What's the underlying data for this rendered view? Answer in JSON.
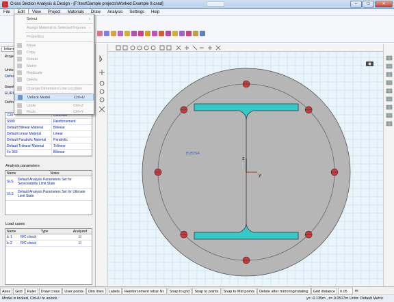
{
  "window": {
    "title": "Cross Section Analysis & Design - [F:\\test\\Sample projects\\Worked Example 9.csad]",
    "min": "–",
    "max": "□",
    "close": "✕"
  },
  "menu": [
    "File",
    "Edit",
    "View",
    "Project",
    "Materials",
    "Draw",
    "Analysis",
    "Settings",
    "Help"
  ],
  "edit_menu": {
    "select": "Select",
    "assign_material": "Assign Material to Selected Figures",
    "properties": "Properties",
    "move": "Move",
    "copy": "Copy",
    "rotate": "Rotate",
    "mirror": "Mirror",
    "replicate": "Replicate",
    "delete": "Delete",
    "change_dim": "Change Dimension Line Location",
    "unlock": "Unlock Model",
    "unlock_sc": "Ctrl+U",
    "undo": "Undo",
    "undo_sc": "Ctrl+Z",
    "redo": "Redo",
    "redo_sc": "Ctrl+Y"
  },
  "left": {
    "tab": "Informa",
    "proj": "Proje",
    "units": "Units",
    "units_val": "Defau",
    "reinf": "Reinf",
    "reinf_val": "EURO",
    "defi": "Defin",
    "materials": [
      {
        "name": "C20",
        "type": "Concrete"
      },
      {
        "name": "S500",
        "type": "Reinforcement"
      },
      {
        "name": "Default Bilinear Material",
        "type": "Bilinear"
      },
      {
        "name": "Default Linear Material",
        "type": "Linear"
      },
      {
        "name": "Default Parabolic Material",
        "type": "Parabolic"
      },
      {
        "name": "Default Trilinear Material",
        "type": "Trilinear"
      },
      {
        "name": "Fe 360",
        "type": "Bilinear"
      }
    ],
    "analysis_title": "Analysis parameters",
    "analysis_headers": {
      "name": "Name",
      "notes": "Notes"
    },
    "analysis_rows": [
      {
        "name": "SLS",
        "notes": "Default Analysis Parameters Set for Serviceability Limit State"
      },
      {
        "name": "ULS",
        "notes": "Default Analysis Parameters Set for Ultimate Limit State"
      }
    ],
    "loads_title": "Load cases",
    "loads_headers": {
      "name": "Name",
      "type": "Type",
      "analyzed": "Analyzed"
    },
    "loads_rows": [
      {
        "name": "lc 1",
        "type": "R/C check",
        "analyzed": "☑"
      },
      {
        "name": "lc 2",
        "type": "R/C check",
        "analyzed": "☑"
      }
    ]
  },
  "canvas": {
    "axis_labels": {
      "x": "y",
      "y": "z"
    },
    "material_label": "ELEDSA"
  },
  "bottom_tabs": [
    "Axes",
    "Grid",
    "Ruler",
    "Draw cross",
    "User points",
    "Dim lines",
    "Labels",
    "Reinforcement rebar Nr.",
    "Snap to grid",
    "Snap to points",
    "Snap to Mid points",
    "Delete after mirroring/rotating",
    "Grid distance",
    "0.05",
    "m"
  ],
  "status": {
    "message": "Model is locked, Ctrl+U to unlock.",
    "coords": "y= -0.135m , z= 0.0517m",
    "units": "Units: Default Metric"
  },
  "colors": {
    "section_fill": "#b6b6b6",
    "steel_fill": "#36c9c9",
    "rebar_fill": "#c83a3a",
    "grid_bg": "#eaf4fb",
    "highlight": "#d6e7fb"
  }
}
